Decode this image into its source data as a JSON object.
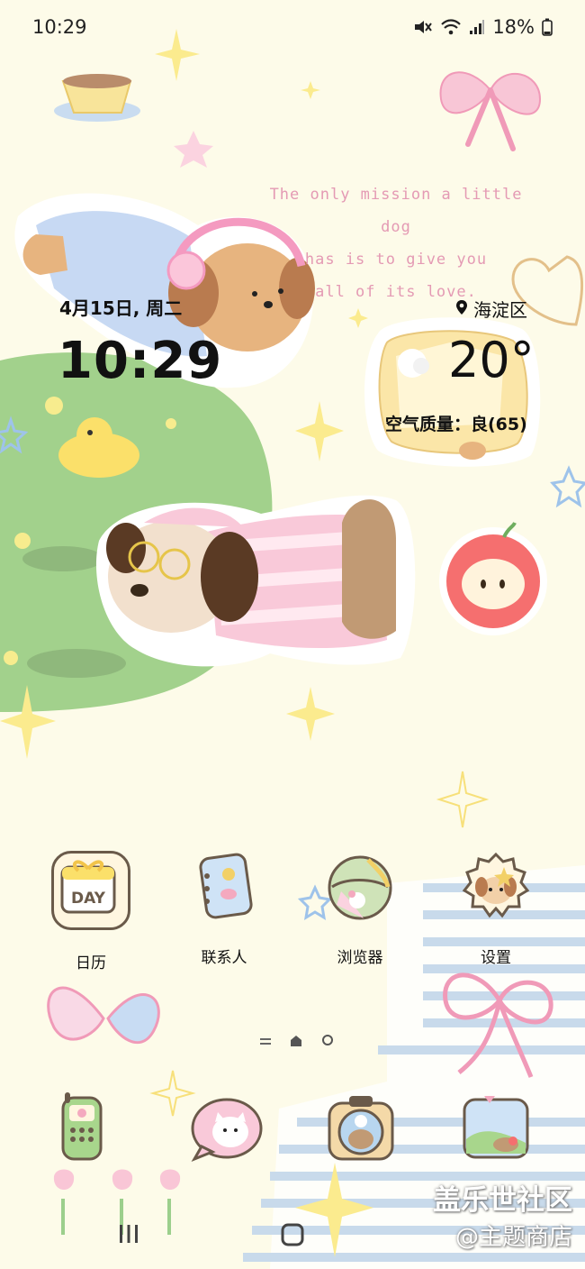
{
  "status_bar": {
    "time": "10:29",
    "battery": "18%"
  },
  "wallpaper": {
    "quote": [
      "The only mission a little dog",
      "has is to give you",
      "all of its love."
    ]
  },
  "widget": {
    "date": "4月15日, 周二",
    "time": "10:29",
    "location": "海淀区",
    "temperature": "20°",
    "air_quality": "空气质量：良(65)"
  },
  "apps": [
    {
      "label": "日历",
      "icon": "calendar-icon"
    },
    {
      "label": "联系人",
      "icon": "contacts-icon"
    },
    {
      "label": "浏览器",
      "icon": "browser-icon"
    },
    {
      "label": "设置",
      "icon": "settings-icon"
    }
  ],
  "dock": [
    {
      "icon": "phone-icon"
    },
    {
      "icon": "messages-icon"
    },
    {
      "icon": "camera-icon"
    },
    {
      "icon": "gallery-icon"
    }
  ],
  "watermark": {
    "line1": "盖乐世社区",
    "line2": "@主题商店"
  },
  "colors": {
    "background": "#fdfbe9",
    "quote": "#e49ab4",
    "grass": "#9fd08a",
    "pink": "#f7b7cf"
  }
}
